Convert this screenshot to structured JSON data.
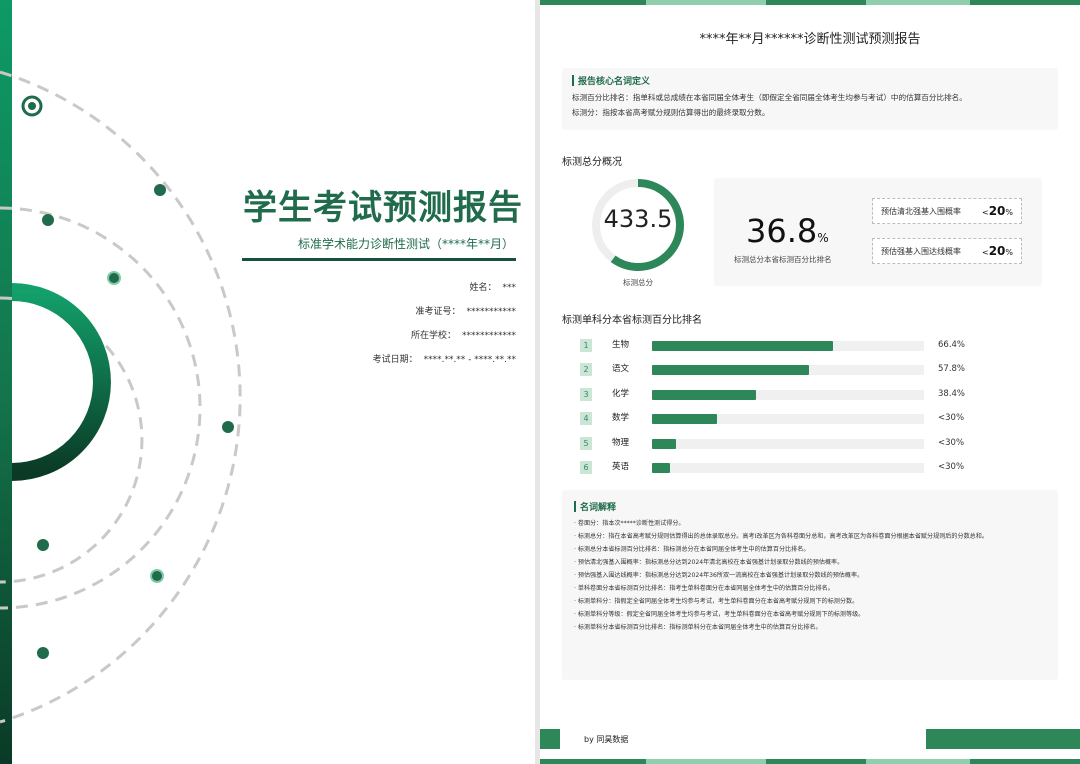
{
  "cover": {
    "title": "学生考试预测报告",
    "subtitle": "标准学术能力诊断性测试（****年**月）",
    "info": [
      {
        "label": "姓名：",
        "value": "***"
      },
      {
        "label": "准考证号：",
        "value": "***********"
      },
      {
        "label": "所在学校：",
        "value": "************"
      },
      {
        "label": "考试日期：",
        "value": "****.**.** - ****.**.**"
      }
    ]
  },
  "report": {
    "title": "****年**月******诊断性测试预测报告",
    "definitions": {
      "heading": "报告核心名词定义",
      "lines": [
        "标测百分比排名：指单科或总成绩在本省同届全体考生（即假定全省同届全体考生均参与考试）中的估算百分比排名。",
        "标测分：指按本省高考赋分规则估算得出的最终录取分数。"
      ]
    },
    "overview": {
      "section_title": "标测总分概况",
      "total_score": "433.5",
      "score_fraction": 0.6,
      "score_label": "标测总分",
      "percentile_value": "36.8",
      "percentile_unit": "%",
      "percentile_label": "标测总分本省标测百分比排名",
      "probabilities": [
        {
          "label": "预估清北强基入围概率",
          "prefix": "<",
          "value": "20",
          "unit": "%"
        },
        {
          "label": "预估强基入围达线概率",
          "prefix": "<",
          "value": "20",
          "unit": "%"
        }
      ]
    },
    "ranking": {
      "section_title": "标测单科分本省标测百分比排名",
      "subjects": [
        {
          "rank": "1",
          "name": "生物",
          "value": "66.4%",
          "fraction": 0.664
        },
        {
          "rank": "2",
          "name": "语文",
          "value": "57.8%",
          "fraction": 0.578
        },
        {
          "rank": "3",
          "name": "化学",
          "value": "38.4%",
          "fraction": 0.384
        },
        {
          "rank": "4",
          "name": "数学",
          "value": "<30%",
          "fraction": 0.24
        },
        {
          "rank": "5",
          "name": "物理",
          "value": "<30%",
          "fraction": 0.09
        },
        {
          "rank": "6",
          "name": "英语",
          "value": "<30%",
          "fraction": 0.065
        }
      ]
    },
    "glossary": {
      "heading": "名词解释",
      "lines": [
        "· 卷面分：指本次*****诊断性测试得分。",
        "· 标测总分：指在本省高考赋分规则估算得出的总体录取总分。高考Ⅰ改革区为各科卷面分总和，高考改革区为各科卷面分根据本省赋分规则后的分数总和。",
        "· 标测总分本省标测百分比排名：指标测总分在本省同届全体考生中的估算百分比排名。",
        "· 预估清北强基入围概率：指标测总分达到2024年清北高校在本省强基计划录取分数线的预估概率。",
        "· 预估强基入围达线概率：指标测总分达到2024年36所双一流高校在本省强基计划录取分数线的预估概率。",
        "· 单科卷面分本省标测百分比排名：指考生单科卷面分在本省同届全体考生中的估算百分比排名。",
        "· 标测单科分：指假定全省同届全体考生均参与考试，考生单科卷面分在本省高考赋分规则下的标测分数。",
        "· 标测单科分等级：假定全省同届全体考生均参与考试，考生单科卷面分在本省高考赋分规则下的标测等级。",
        "· 标测单科分本省标测百分比排名：指标测单科分在本省同届全体考生中的估算百分比排名。"
      ]
    },
    "footer": "by 同昊数据"
  }
}
